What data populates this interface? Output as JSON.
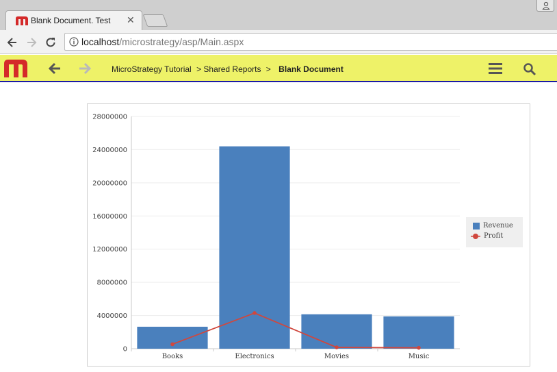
{
  "browser": {
    "tab_title": "Blank Document. Test",
    "url_host": "localhost",
    "url_path": "/microstrategy/asp/Main.aspx"
  },
  "app": {
    "breadcrumbs": [
      "MicroStrategy Tutorial",
      "> Shared Reports",
      ">"
    ],
    "current_document": "Blank Document"
  },
  "colors": {
    "appbar": "#eef268",
    "revenue": "#4a80bd",
    "profit": "#d0473d"
  },
  "icons": {
    "favicon": "microstrategy-m-icon",
    "back": "arrow-left-icon",
    "forward": "arrow-right-icon",
    "reload": "reload-icon",
    "info": "info-icon",
    "menu": "hamburger-icon",
    "search": "search-icon",
    "profile": "person-icon"
  },
  "chart_data": {
    "type": "bar",
    "categories": [
      "Books",
      "Electronics",
      "Movies",
      "Music"
    ],
    "series": [
      {
        "name": "Revenue",
        "type": "bar",
        "values": [
          2650000,
          24400000,
          4150000,
          3900000
        ]
      },
      {
        "name": "Profit",
        "type": "line",
        "values": [
          540000,
          4300000,
          160000,
          110000
        ]
      }
    ],
    "ylim": [
      0,
      28000000
    ],
    "yticks": [
      "0",
      "4000000",
      "8000000",
      "12000000",
      "16000000",
      "20000000",
      "24000000",
      "28000000"
    ],
    "grid": true,
    "legend_position": "right"
  }
}
